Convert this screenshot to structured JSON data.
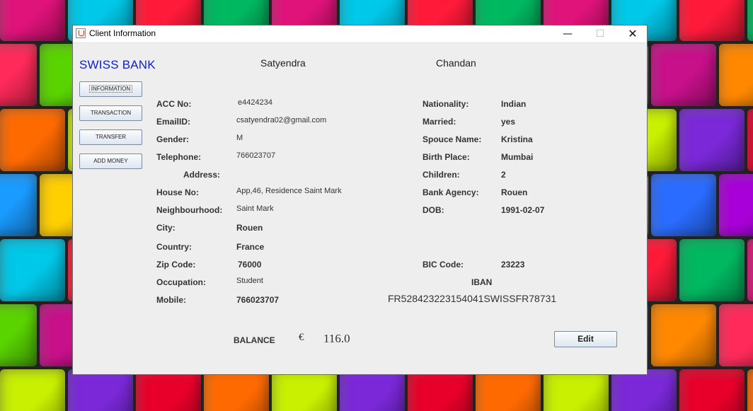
{
  "window": {
    "title": "Client Information"
  },
  "header": {
    "brand": "SWISS BANK",
    "first_name": "Satyendra",
    "last_name": "Chandan"
  },
  "sidebar": {
    "items": [
      {
        "label": "INFORMATION"
      },
      {
        "label": "TRANSACTION"
      },
      {
        "label": "TRANSFER"
      },
      {
        "label": "ADD MONEY"
      }
    ]
  },
  "left_fields": {
    "acc_no": {
      "label": "ACC No:",
      "value": "e4424234"
    },
    "email": {
      "label": "EmailID:",
      "value": "csatyendra02@gmail.com"
    },
    "gender": {
      "label": "Gender:",
      "value": "M"
    },
    "telephone": {
      "label": "Telephone:",
      "value": "766023707"
    },
    "address": {
      "label": "Address:"
    },
    "house_no": {
      "label": "House No:",
      "value": "App,46, Residence Saint Mark"
    },
    "neighbourhood": {
      "label": "Neighbourhood:",
      "value": "Saint Mark"
    },
    "city": {
      "label": "City:",
      "value": "Rouen"
    },
    "country": {
      "label": "Country:",
      "value": "France"
    },
    "zip": {
      "label": "Zip Code:",
      "value": "76000"
    },
    "occupation": {
      "label": "Occupation:",
      "value": "Student"
    },
    "mobile": {
      "label": "Mobile:",
      "value": "766023707"
    }
  },
  "right_fields": {
    "nationality": {
      "label": "Nationality:",
      "value": "Indian"
    },
    "married": {
      "label": "Married:",
      "value": "yes"
    },
    "spouse": {
      "label": "Spouce Name:",
      "value": "Kristina"
    },
    "birth_place": {
      "label": "Birth Place:",
      "value": "Mumbai"
    },
    "children": {
      "label": "Children:",
      "value": "2"
    },
    "bank_agency": {
      "label": "Bank Agency:",
      "value": "Rouen"
    },
    "dob": {
      "label": "DOB:",
      "value": "1991-02-07"
    },
    "bic": {
      "label": "BIC Code:",
      "value": "23223"
    },
    "iban": {
      "label": "IBAN",
      "value": "FR528423223154041SWISSFR78731"
    }
  },
  "balance": {
    "label": "BALANCE",
    "currency": "€",
    "amount": "116.0"
  },
  "actions": {
    "edit_label": "Edit"
  },
  "title_buttons": {
    "minimize": "—",
    "maximize": "☐",
    "close": "✕"
  }
}
